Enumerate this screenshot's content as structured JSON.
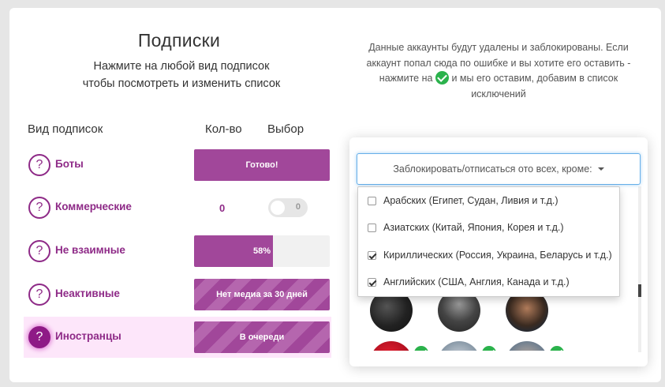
{
  "header": {
    "title": "Подписки",
    "subtitle": "Нажмите на любой вид подписок чтобы посмотреть и изменить список"
  },
  "columns": {
    "type": "Вид подписок",
    "count": "Кол-во",
    "choice": "Выбор"
  },
  "rows": [
    {
      "label": "Боты",
      "bar_text": "Готово!",
      "progress_percent": 100,
      "striped": false
    },
    {
      "label": "Коммерческие",
      "count": "0",
      "toggle_text": "0"
    },
    {
      "label": "Не взаимные",
      "bar_text": "58%",
      "progress_percent": 58,
      "striped": false
    },
    {
      "label": "Неактивные",
      "bar_text": "Нет медиа за 30 дней",
      "progress_percent": 100,
      "striped": true
    },
    {
      "label": "Иностранцы",
      "bar_text": "В очереди",
      "progress_percent": 100,
      "striped": true,
      "active": true
    }
  ],
  "help_glyph": "?",
  "notice": {
    "line1": "Данные аккаунты будут удалены и заблокированы. Если аккаунт попал сюда по ошибке и вы хотите его оставить - нажмите на",
    "line2": "и мы его оставим, добавим в список исключений"
  },
  "dropdown": {
    "button_label": "Заблокировать/отписаться ото всех, кроме:",
    "options": [
      {
        "label": "Арабских (Египет, Судан, Ливия и т.д.)",
        "checked": false
      },
      {
        "label": "Азиатских (Китай, Япония, Корея и т.д.)",
        "checked": false
      },
      {
        "label": "Кириллических (Россия, Украина, Беларусь и т.д.)",
        "checked": true
      },
      {
        "label": "Английских (США, Англия, Канада и т.д.)",
        "checked": true
      }
    ]
  },
  "colors": {
    "accent": "#8e2a87",
    "bar": "#a1479a",
    "active_row": "#fde6fa",
    "check": "#2bb24c"
  }
}
